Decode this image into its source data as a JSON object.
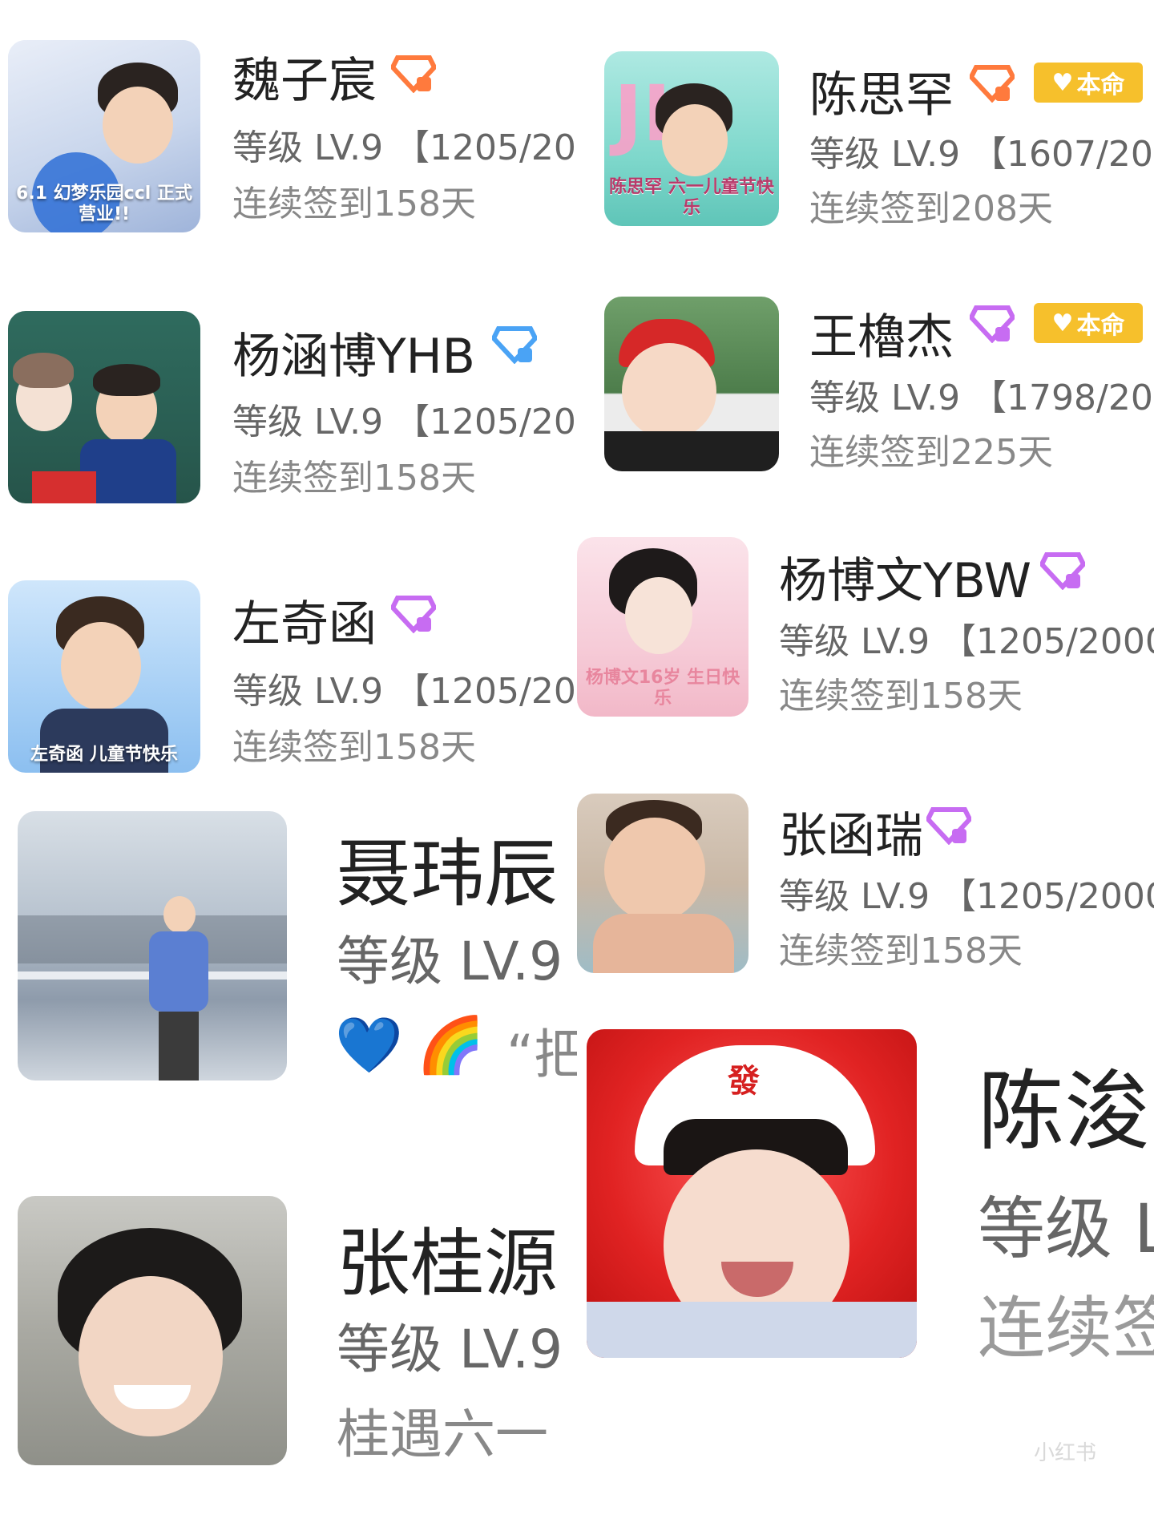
{
  "cards": [
    {
      "name": "魏子宸",
      "level": "等级 LV.9 【1205/20",
      "signin": "连续签到158天",
      "avatar_caption": "6.1 幻梦乐园ccl 正式营业!!",
      "gem_color": "#ff7a3d",
      "gem_icon": "diamond-icon"
    },
    {
      "name": "陈思罕",
      "level": "等级 LV.9 【1607/200",
      "signin": "连续签到208天",
      "avatar_caption": "陈思罕 六一儿童节快乐",
      "avatar_banner": "JK",
      "gem_color": "#ff7a3d",
      "gem_icon": "diamond-icon",
      "badge": "本命"
    },
    {
      "name": "杨涵博YHB",
      "level": "等级 LV.9 【1205/20",
      "signin": "连续签到158天",
      "gem_color": "#4aa3f5",
      "gem_icon": "diamond-icon"
    },
    {
      "name": "王櫓杰",
      "level": "等级 LV.9 【1798/200",
      "signin": "连续签到225天",
      "gem_color": "#c76cf2",
      "gem_icon": "diamond-icon",
      "badge": "本命"
    },
    {
      "name": "左奇函",
      "level": "等级 LV.9 【1205/20",
      "signin": "连续签到158天",
      "avatar_caption": "左奇函 儿童节快乐",
      "gem_color": "#c76cf2",
      "gem_icon": "diamond-icon"
    },
    {
      "name": "杨博文YBW",
      "level": "等级 LV.9 【1205/2000",
      "signin": "连续签到158天",
      "avatar_caption": "杨博文16岁 生日快乐",
      "gem_color": "#c76cf2",
      "gem_icon": "diamond-icon"
    },
    {
      "name": "聂玮辰",
      "level": "等级 LV.9",
      "signin": "“把",
      "emoji1": "💙",
      "emoji2": "🌈",
      "gem_color": "#4aa3f5",
      "gem_icon": "diamond-icon"
    },
    {
      "name": "张函瑞",
      "level": "等级 LV.9 【1205/2000",
      "signin": "连续签到158天",
      "gem_color": "#c76cf2",
      "gem_icon": "diamond-icon"
    },
    {
      "name": "陈浚",
      "level": "等级 L",
      "signin": "连续签",
      "avatar_mark": "發"
    },
    {
      "name": "张桂源",
      "level": "等级 LV.9",
      "signin": "桂遇六一",
      "gem_color": "#c76cf2",
      "gem_icon": "diamond-icon"
    }
  ],
  "badge_icon": "heart-icon",
  "watermark": "小红书"
}
